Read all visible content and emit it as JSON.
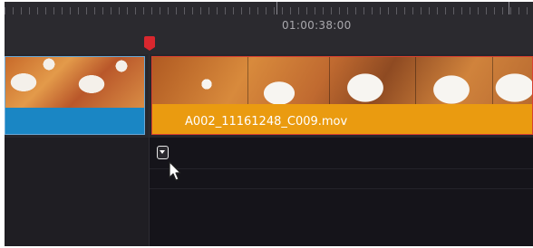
{
  "ruler": {
    "timecode": "01:00:38:00"
  },
  "clips": {
    "left": {
      "color": "#1a86c4"
    },
    "right": {
      "name": "A002_11161248_C009.mov",
      "color": "#ea9b10",
      "border_color": "#d94030"
    }
  },
  "playhead": {
    "color": "#d9272e"
  },
  "controls": {
    "dropdown": "chevron-down-icon"
  },
  "cursor": {
    "icon": "mouse-pointer-icon"
  }
}
